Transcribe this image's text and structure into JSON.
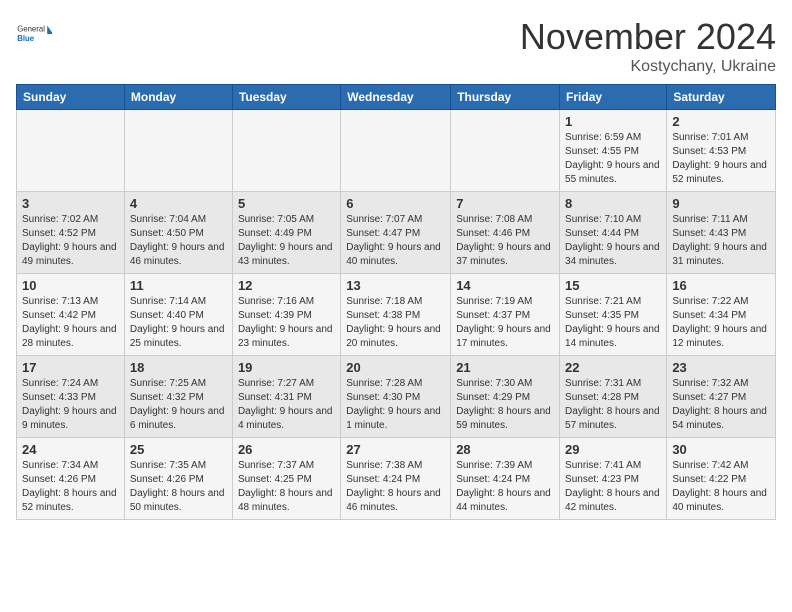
{
  "logo": {
    "general": "General",
    "blue": "Blue"
  },
  "title": "November 2024",
  "location": "Kostychany, Ukraine",
  "days_header": [
    "Sunday",
    "Monday",
    "Tuesday",
    "Wednesday",
    "Thursday",
    "Friday",
    "Saturday"
  ],
  "weeks": [
    [
      {
        "num": "",
        "info": ""
      },
      {
        "num": "",
        "info": ""
      },
      {
        "num": "",
        "info": ""
      },
      {
        "num": "",
        "info": ""
      },
      {
        "num": "",
        "info": ""
      },
      {
        "num": "1",
        "info": "Sunrise: 6:59 AM\nSunset: 4:55 PM\nDaylight: 9 hours and 55 minutes."
      },
      {
        "num": "2",
        "info": "Sunrise: 7:01 AM\nSunset: 4:53 PM\nDaylight: 9 hours and 52 minutes."
      }
    ],
    [
      {
        "num": "3",
        "info": "Sunrise: 7:02 AM\nSunset: 4:52 PM\nDaylight: 9 hours and 49 minutes."
      },
      {
        "num": "4",
        "info": "Sunrise: 7:04 AM\nSunset: 4:50 PM\nDaylight: 9 hours and 46 minutes."
      },
      {
        "num": "5",
        "info": "Sunrise: 7:05 AM\nSunset: 4:49 PM\nDaylight: 9 hours and 43 minutes."
      },
      {
        "num": "6",
        "info": "Sunrise: 7:07 AM\nSunset: 4:47 PM\nDaylight: 9 hours and 40 minutes."
      },
      {
        "num": "7",
        "info": "Sunrise: 7:08 AM\nSunset: 4:46 PM\nDaylight: 9 hours and 37 minutes."
      },
      {
        "num": "8",
        "info": "Sunrise: 7:10 AM\nSunset: 4:44 PM\nDaylight: 9 hours and 34 minutes."
      },
      {
        "num": "9",
        "info": "Sunrise: 7:11 AM\nSunset: 4:43 PM\nDaylight: 9 hours and 31 minutes."
      }
    ],
    [
      {
        "num": "10",
        "info": "Sunrise: 7:13 AM\nSunset: 4:42 PM\nDaylight: 9 hours and 28 minutes."
      },
      {
        "num": "11",
        "info": "Sunrise: 7:14 AM\nSunset: 4:40 PM\nDaylight: 9 hours and 25 minutes."
      },
      {
        "num": "12",
        "info": "Sunrise: 7:16 AM\nSunset: 4:39 PM\nDaylight: 9 hours and 23 minutes."
      },
      {
        "num": "13",
        "info": "Sunrise: 7:18 AM\nSunset: 4:38 PM\nDaylight: 9 hours and 20 minutes."
      },
      {
        "num": "14",
        "info": "Sunrise: 7:19 AM\nSunset: 4:37 PM\nDaylight: 9 hours and 17 minutes."
      },
      {
        "num": "15",
        "info": "Sunrise: 7:21 AM\nSunset: 4:35 PM\nDaylight: 9 hours and 14 minutes."
      },
      {
        "num": "16",
        "info": "Sunrise: 7:22 AM\nSunset: 4:34 PM\nDaylight: 9 hours and 12 minutes."
      }
    ],
    [
      {
        "num": "17",
        "info": "Sunrise: 7:24 AM\nSunset: 4:33 PM\nDaylight: 9 hours and 9 minutes."
      },
      {
        "num": "18",
        "info": "Sunrise: 7:25 AM\nSunset: 4:32 PM\nDaylight: 9 hours and 6 minutes."
      },
      {
        "num": "19",
        "info": "Sunrise: 7:27 AM\nSunset: 4:31 PM\nDaylight: 9 hours and 4 minutes."
      },
      {
        "num": "20",
        "info": "Sunrise: 7:28 AM\nSunset: 4:30 PM\nDaylight: 9 hours and 1 minute."
      },
      {
        "num": "21",
        "info": "Sunrise: 7:30 AM\nSunset: 4:29 PM\nDaylight: 8 hours and 59 minutes."
      },
      {
        "num": "22",
        "info": "Sunrise: 7:31 AM\nSunset: 4:28 PM\nDaylight: 8 hours and 57 minutes."
      },
      {
        "num": "23",
        "info": "Sunrise: 7:32 AM\nSunset: 4:27 PM\nDaylight: 8 hours and 54 minutes."
      }
    ],
    [
      {
        "num": "24",
        "info": "Sunrise: 7:34 AM\nSunset: 4:26 PM\nDaylight: 8 hours and 52 minutes."
      },
      {
        "num": "25",
        "info": "Sunrise: 7:35 AM\nSunset: 4:26 PM\nDaylight: 8 hours and 50 minutes."
      },
      {
        "num": "26",
        "info": "Sunrise: 7:37 AM\nSunset: 4:25 PM\nDaylight: 8 hours and 48 minutes."
      },
      {
        "num": "27",
        "info": "Sunrise: 7:38 AM\nSunset: 4:24 PM\nDaylight: 8 hours and 46 minutes."
      },
      {
        "num": "28",
        "info": "Sunrise: 7:39 AM\nSunset: 4:24 PM\nDaylight: 8 hours and 44 minutes."
      },
      {
        "num": "29",
        "info": "Sunrise: 7:41 AM\nSunset: 4:23 PM\nDaylight: 8 hours and 42 minutes."
      },
      {
        "num": "30",
        "info": "Sunrise: 7:42 AM\nSunset: 4:22 PM\nDaylight: 8 hours and 40 minutes."
      }
    ]
  ]
}
